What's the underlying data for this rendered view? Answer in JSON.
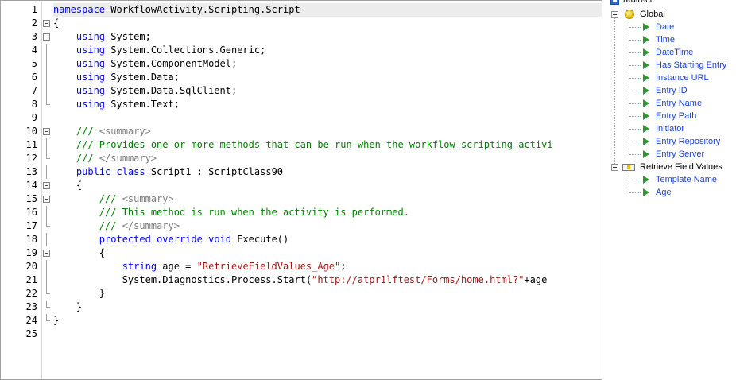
{
  "editor": {
    "line_numbers": [
      "1",
      "2",
      "3",
      "4",
      "5",
      "6",
      "7",
      "8",
      "9",
      "10",
      "11",
      "12",
      "13",
      "14",
      "15",
      "16",
      "17",
      "18",
      "19",
      "20",
      "21",
      "22",
      "23",
      "24",
      "25"
    ],
    "lines": [
      [
        {
          "t": "namespace",
          "c": "kw"
        },
        {
          "t": " WorkflowActivity.Scripting.Script"
        }
      ],
      [
        {
          "t": "{"
        }
      ],
      [
        {
          "t": "    "
        },
        {
          "t": "using",
          "c": "kw"
        },
        {
          "t": " System;"
        }
      ],
      [
        {
          "t": "    "
        },
        {
          "t": "using",
          "c": "kw"
        },
        {
          "t": " System.Collections.Generic;"
        }
      ],
      [
        {
          "t": "    "
        },
        {
          "t": "using",
          "c": "kw"
        },
        {
          "t": " System.ComponentModel;"
        }
      ],
      [
        {
          "t": "    "
        },
        {
          "t": "using",
          "c": "kw"
        },
        {
          "t": " System.Data;"
        }
      ],
      [
        {
          "t": "    "
        },
        {
          "t": "using",
          "c": "kw"
        },
        {
          "t": " System.Data.SqlClient;"
        }
      ],
      [
        {
          "t": "    "
        },
        {
          "t": "using",
          "c": "kw"
        },
        {
          "t": " System.Text;"
        }
      ],
      [],
      [
        {
          "t": "    "
        },
        {
          "t": "///",
          "c": "cm"
        },
        {
          "t": " <summary>",
          "c": "xd"
        }
      ],
      [
        {
          "t": "    "
        },
        {
          "t": "/// Provides one or more methods that can be run when the workflow scripting activi",
          "c": "cm"
        }
      ],
      [
        {
          "t": "    "
        },
        {
          "t": "///",
          "c": "cm"
        },
        {
          "t": " </summary>",
          "c": "xd"
        }
      ],
      [
        {
          "t": "    "
        },
        {
          "t": "public",
          "c": "kw"
        },
        {
          "t": " "
        },
        {
          "t": "class",
          "c": "kw"
        },
        {
          "t": " Script1 : ScriptClass90"
        }
      ],
      [
        {
          "t": "    {"
        }
      ],
      [
        {
          "t": "        "
        },
        {
          "t": "///",
          "c": "cm"
        },
        {
          "t": " <summary>",
          "c": "xd"
        }
      ],
      [
        {
          "t": "        "
        },
        {
          "t": "/// This method is run when the activity is performed.",
          "c": "cm"
        }
      ],
      [
        {
          "t": "        "
        },
        {
          "t": "///",
          "c": "cm"
        },
        {
          "t": " </summary>",
          "c": "xd"
        }
      ],
      [
        {
          "t": "        "
        },
        {
          "t": "protected",
          "c": "kw"
        },
        {
          "t": " "
        },
        {
          "t": "override",
          "c": "kw"
        },
        {
          "t": " "
        },
        {
          "t": "void",
          "c": "kw"
        },
        {
          "t": " Execute()"
        }
      ],
      [
        {
          "t": "        {"
        }
      ],
      [
        {
          "t": "            "
        },
        {
          "t": "string",
          "c": "kw"
        },
        {
          "t": " age = "
        },
        {
          "t": "\"RetrieveFieldValues_Age\"",
          "c": "st"
        },
        {
          "t": ";"
        },
        {
          "caret": true
        }
      ],
      [
        {
          "t": "            System.Diagnostics.Process.Start("
        },
        {
          "t": "\"http://atpr1lftest/Forms/home.html?\"",
          "c": "st"
        },
        {
          "t": "+age"
        }
      ],
      [
        {
          "t": "        }"
        }
      ],
      [
        {
          "t": "    }"
        }
      ],
      [
        {
          "t": "}"
        }
      ],
      []
    ]
  },
  "tree": {
    "root": {
      "label": "redirect"
    },
    "global": {
      "label": "Global"
    },
    "global_items": [
      "Date",
      "Time",
      "DateTime",
      "Has Starting Entry",
      "Instance URL",
      "Entry ID",
      "Entry Name",
      "Entry Path",
      "Initiator",
      "Entry Repository",
      "Entry Server"
    ],
    "retrieve": {
      "label": "Retrieve Field Values"
    },
    "retrieve_items": [
      "Template Name",
      "Age"
    ],
    "colors": {
      "token": "#1a3fd9",
      "arrow": "#2e9a2e"
    },
    "icons": {
      "root": "workflow-icon",
      "global": "global-token-icon",
      "token": "play-arrow-icon",
      "retrieve": "field-values-icon"
    }
  }
}
